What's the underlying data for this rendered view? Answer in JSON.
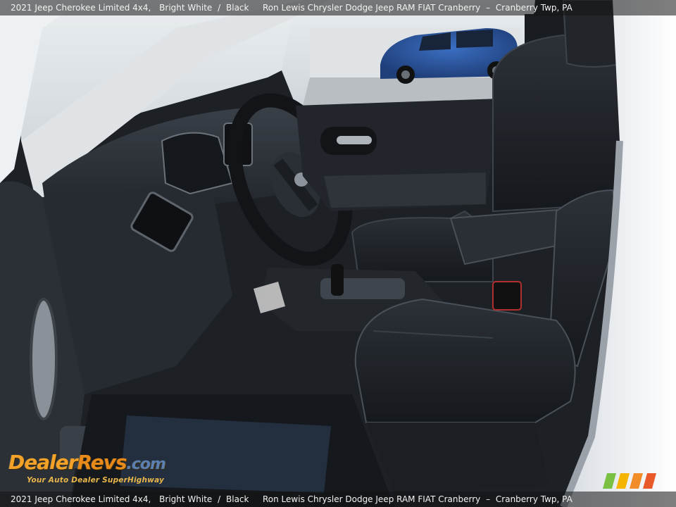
{
  "caption": {
    "vehicle": "2021 Jeep Cherokee Limited 4x4,",
    "exterior_color": "Bright White",
    "separator": "/",
    "interior_color": "Black",
    "dealer": "Ron Lewis Chrysler Dodge Jeep RAM FIAT Cranberry",
    "dash": "–",
    "location": "Cranberry Twp, PA"
  },
  "watermark": {
    "logo_part1": "Dealer",
    "logo_part2": "Revs",
    "logo_part3": ".com",
    "tagline": "Your Auto Dealer SuperHighway"
  },
  "colors": {
    "bar_bg": "#141414",
    "bar_text": "#f2f2f2",
    "logo_orange": "#f3a229",
    "stripes": [
      "#7ac143",
      "#f4b400",
      "#f28c28",
      "#e95a2b"
    ]
  }
}
